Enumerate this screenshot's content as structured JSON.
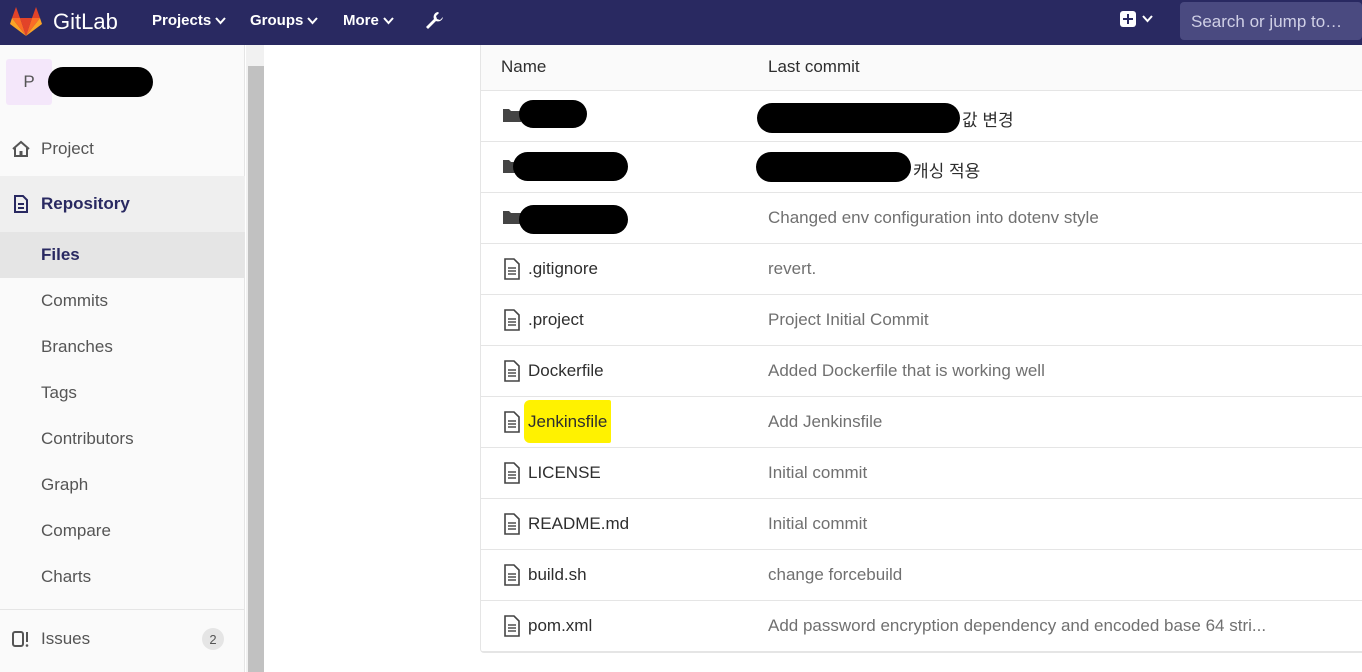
{
  "navbar": {
    "brand": "GitLab",
    "projects_label": "Projects",
    "groups_label": "Groups",
    "more_label": "More",
    "search_placeholder": "Search or jump to…",
    "bg_color": "#292961"
  },
  "sidebar": {
    "project_initial": "P",
    "items": [
      {
        "label": "Project",
        "icon": "home-icon"
      },
      {
        "label": "Repository",
        "icon": "document-icon"
      },
      {
        "label": "Files"
      },
      {
        "label": "Commits"
      },
      {
        "label": "Branches"
      },
      {
        "label": "Tags"
      },
      {
        "label": "Contributors"
      },
      {
        "label": "Graph"
      },
      {
        "label": "Compare"
      },
      {
        "label": "Charts"
      },
      {
        "label": "Issues",
        "icon": "issues-icon",
        "count": "2"
      }
    ]
  },
  "table": {
    "header": {
      "name": "Name",
      "last_commit": "Last commit"
    },
    "rows": [
      {
        "type": "folder",
        "name": "",
        "commit": "값 변경"
      },
      {
        "type": "folder",
        "name": "",
        "commit": "캐싱 적용"
      },
      {
        "type": "folder",
        "name": "",
        "commit": "Changed env configuration into dotenv style"
      },
      {
        "type": "file",
        "name": ".gitignore",
        "commit": "revert."
      },
      {
        "type": "file",
        "name": ".project",
        "commit": "Project Initial Commit"
      },
      {
        "type": "file",
        "name": "Dockerfile",
        "commit": "Added Dockerfile that is working well"
      },
      {
        "type": "file",
        "name": "Jenkinsfile",
        "commit": "Add Jenkinsfile",
        "highlight": "#fff200"
      },
      {
        "type": "file",
        "name": "LICENSE",
        "commit": "Initial commit"
      },
      {
        "type": "file",
        "name": "README.md",
        "commit": "Initial commit"
      },
      {
        "type": "file",
        "name": "build.sh",
        "commit": "change forcebuild"
      },
      {
        "type": "file",
        "name": "pom.xml",
        "commit": "Add password encryption dependency and encoded base 64 stri..."
      }
    ]
  }
}
